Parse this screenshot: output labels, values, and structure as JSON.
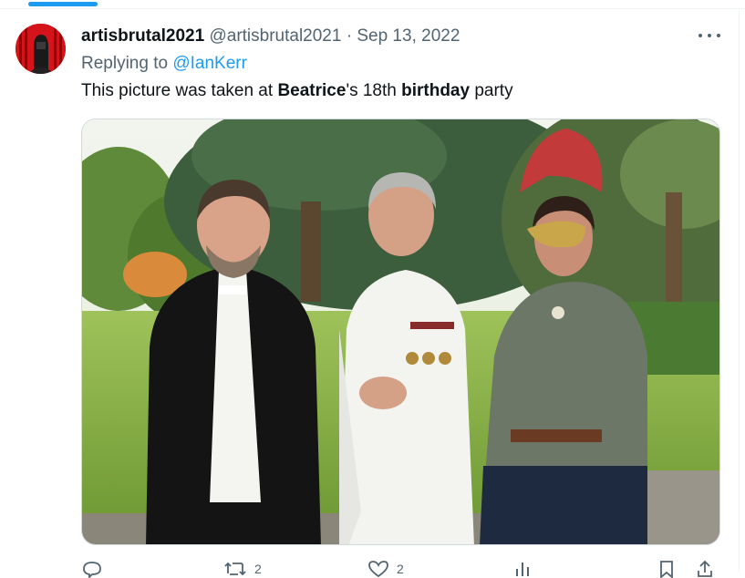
{
  "tweet": {
    "display_name": "artisbrutal2021",
    "handle": "@artisbrutal2021",
    "separator": "·",
    "date": "Sep 13, 2022",
    "replying_to_label": "Replying to",
    "replying_to_handle": "@IanKerr",
    "text_parts": [
      "This picture was taken at ",
      "Beatrice",
      "'s 18th ",
      "birthday",
      " party"
    ]
  },
  "actions": {
    "reply_count": "",
    "retweet_count": "2",
    "like_count": "2"
  },
  "icons": [
    "more-icon",
    "reply-icon",
    "retweet-icon",
    "like-icon",
    "views-icon",
    "bookmark-icon",
    "share-icon"
  ],
  "colors": {
    "accent": "#1d9bf0",
    "secondary_text": "#536471",
    "border": "#cfd9de"
  }
}
